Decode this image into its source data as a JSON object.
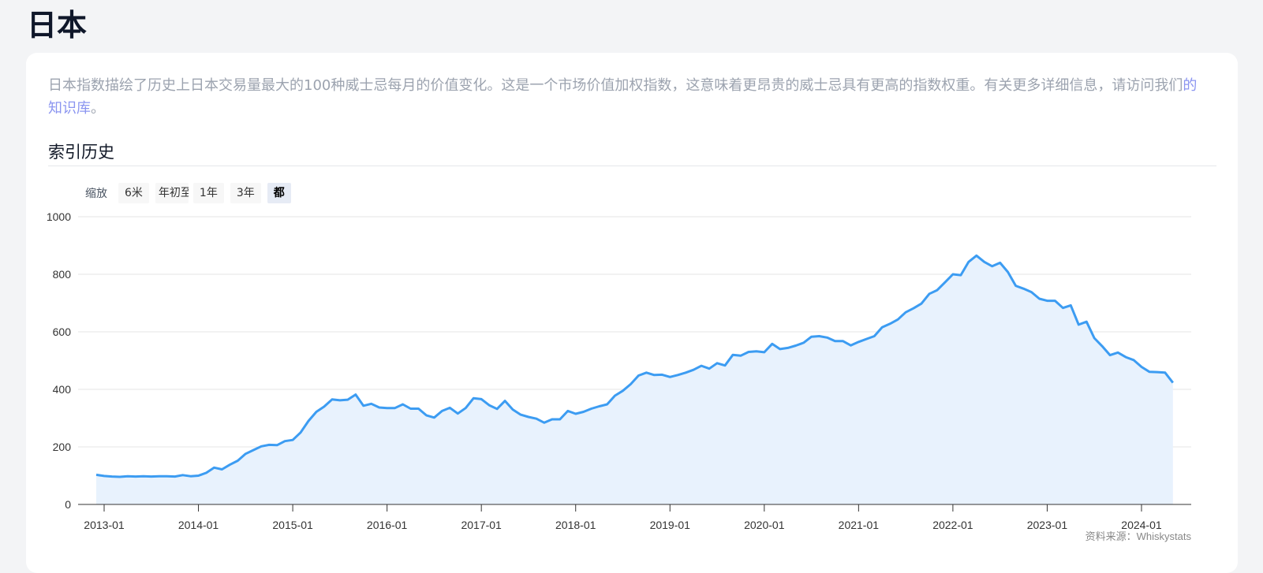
{
  "header": {
    "title": "日本"
  },
  "intro": {
    "text": "日本指数描绘了历史上日本交易量最大的100种威士忌每月的价值变化。这是一个市场价值加权指数，这意味着更昂贵的威士忌具有更高的指数权重。有关更多详细信息，请访问我们",
    "link": "的知识库",
    "suffix": "。"
  },
  "section": {
    "title": "索引历史"
  },
  "zoom": {
    "label": "缩放",
    "buttons": [
      "6米",
      "年初至今",
      "1年",
      "3年",
      "都"
    ],
    "selected": "都"
  },
  "source": "资料来源：Whiskystats",
  "colors": {
    "line": "#3c9cf2",
    "area": "#e8f2fd"
  },
  "chart_data": {
    "type": "area",
    "ylim": [
      0,
      1000
    ],
    "y_ticks": [
      0,
      200,
      400,
      600,
      800,
      1000
    ],
    "x_ticks": [
      "2013-01",
      "2014-01",
      "2015-01",
      "2016-01",
      "2017-01",
      "2018-01",
      "2019-01",
      "2020-01",
      "2021-01",
      "2022-01",
      "2023-01",
      "2024-01"
    ],
    "grid": true,
    "x": [
      "2012-12",
      "2013-01",
      "2013-02",
      "2013-03",
      "2013-04",
      "2013-05",
      "2013-06",
      "2013-07",
      "2013-08",
      "2013-09",
      "2013-10",
      "2013-11",
      "2013-12",
      "2014-01",
      "2014-02",
      "2014-03",
      "2014-04",
      "2014-05",
      "2014-06",
      "2014-07",
      "2014-08",
      "2014-09",
      "2014-10",
      "2014-11",
      "2014-12",
      "2015-01",
      "2015-02",
      "2015-03",
      "2015-04",
      "2015-05",
      "2015-06",
      "2015-07",
      "2015-08",
      "2015-09",
      "2015-10",
      "2015-11",
      "2015-12",
      "2016-01",
      "2016-02",
      "2016-03",
      "2016-04",
      "2016-05",
      "2016-06",
      "2016-07",
      "2016-08",
      "2016-09",
      "2016-10",
      "2016-11",
      "2016-12",
      "2017-01",
      "2017-02",
      "2017-03",
      "2017-04",
      "2017-05",
      "2017-06",
      "2017-07",
      "2017-08",
      "2017-09",
      "2017-10",
      "2017-11",
      "2017-12",
      "2018-01",
      "2018-02",
      "2018-03",
      "2018-04",
      "2018-05",
      "2018-06",
      "2018-07",
      "2018-08",
      "2018-09",
      "2018-10",
      "2018-11",
      "2018-12",
      "2019-01",
      "2019-02",
      "2019-03",
      "2019-04",
      "2019-05",
      "2019-06",
      "2019-07",
      "2019-08",
      "2019-09",
      "2019-10",
      "2019-11",
      "2019-12",
      "2020-01",
      "2020-02",
      "2020-03",
      "2020-04",
      "2020-05",
      "2020-06",
      "2020-07",
      "2020-08",
      "2020-09",
      "2020-10",
      "2020-11",
      "2020-12",
      "2021-01",
      "2021-02",
      "2021-03",
      "2021-04",
      "2021-05",
      "2021-06",
      "2021-07",
      "2021-08",
      "2021-09",
      "2021-10",
      "2021-11",
      "2021-12",
      "2022-01",
      "2022-02",
      "2022-03",
      "2022-04",
      "2022-05",
      "2022-06",
      "2022-07",
      "2022-08",
      "2022-09",
      "2022-10",
      "2022-11",
      "2022-12",
      "2023-01",
      "2023-02",
      "2023-03",
      "2023-04",
      "2023-05",
      "2023-06",
      "2023-07",
      "2023-08",
      "2023-09",
      "2023-10",
      "2023-11",
      "2023-12",
      "2024-01",
      "2024-02",
      "2024-03",
      "2024-04",
      "2024-05"
    ],
    "values": [
      103,
      99,
      97,
      96,
      98,
      97,
      98,
      97,
      98,
      98,
      97,
      102,
      98,
      100,
      110,
      128,
      122,
      138,
      152,
      176,
      189,
      202,
      207,
      206,
      220,
      224,
      250,
      290,
      322,
      340,
      365,
      362,
      364,
      382,
      343,
      350,
      337,
      335,
      335,
      348,
      333,
      333,
      310,
      302,
      325,
      336,
      316,
      335,
      369,
      366,
      345,
      332,
      360,
      330,
      312,
      304,
      298,
      284,
      296,
      296,
      325,
      315,
      322,
      333,
      341,
      348,
      378,
      395,
      418,
      448,
      458,
      450,
      451,
      443,
      450,
      458,
      468,
      482,
      472,
      491,
      483,
      520,
      517,
      530,
      532,
      529,
      558,
      540,
      544,
      552,
      562,
      583,
      585,
      580,
      568,
      568,
      553,
      565,
      575,
      585,
      616,
      628,
      643,
      668,
      682,
      698,
      732,
      745,
      772,
      800,
      797,
      843,
      865,
      843,
      828,
      840,
      808,
      760,
      750,
      738,
      715,
      708,
      708,
      683,
      692,
      625,
      635,
      578,
      550,
      519,
      528,
      512,
      502,
      478,
      461,
      460,
      458,
      423,
      425
    ]
  }
}
